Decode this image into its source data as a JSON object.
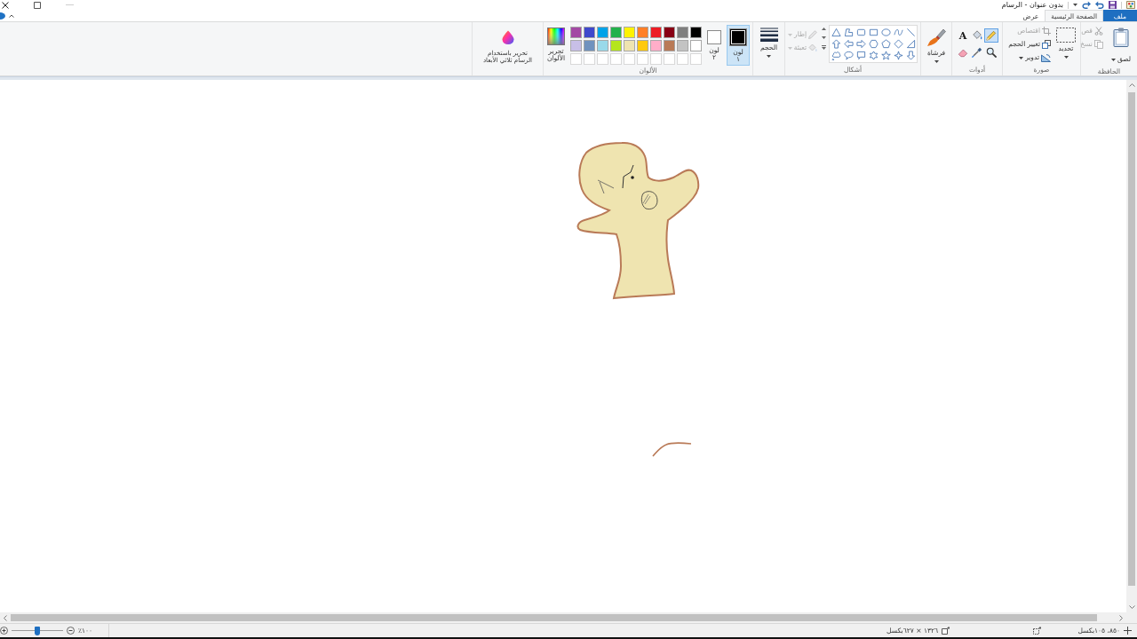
{
  "window": {
    "title": "بدون عنوان - الرسام"
  },
  "tabs": [
    {
      "label": "ملف",
      "kind": "file",
      "selected": false
    },
    {
      "label": "الصفحة الرئيسية",
      "kind": "tab",
      "selected": true
    },
    {
      "label": "عرض",
      "kind": "tab",
      "selected": false
    }
  ],
  "ribbon": {
    "clipboard": {
      "label": "الحافظة",
      "paste": "لصق",
      "cut": {
        "label": "قص",
        "disabled": true
      },
      "copy": {
        "label": "نسخ",
        "disabled": true
      }
    },
    "image": {
      "label": "صورة",
      "select": "تحديد",
      "crop": {
        "label": "اقتصاص",
        "disabled": true
      },
      "resize": {
        "label": "تغيير الحجم",
        "disabled": false
      },
      "rotate": {
        "label": "تدوير",
        "disabled": false
      }
    },
    "tools": {
      "label": "أدوات",
      "items": [
        {
          "kind": "pencil",
          "selected": true
        },
        {
          "kind": "fill",
          "selected": false
        },
        {
          "kind": "text",
          "glyph": "A",
          "selected": false
        },
        {
          "kind": "magnifier",
          "selected": false
        },
        {
          "kind": "picker",
          "selected": false
        },
        {
          "kind": "eraser",
          "selected": false
        }
      ]
    },
    "brushes": {
      "label": "فرشاة"
    },
    "shapes": {
      "label": "أشكال",
      "outline": {
        "label": "إطار",
        "disabled": true
      },
      "fill": {
        "label": "تعبئة",
        "disabled": true
      }
    },
    "size": {
      "label": "الحجم"
    },
    "colors": {
      "label": "الألوان",
      "color_1": {
        "label": "لون ١",
        "color": "#000000",
        "selected": true
      },
      "color_2": {
        "label": "لون ٢",
        "color": "#ffffff",
        "selected": false
      },
      "palette": [
        {
          "kind": "color",
          "color": "#000000"
        },
        {
          "kind": "color",
          "color": "#7f7f7f"
        },
        {
          "kind": "color",
          "color": "#880015"
        },
        {
          "kind": "color",
          "color": "#ed1c24"
        },
        {
          "kind": "color",
          "color": "#ff7f27"
        },
        {
          "kind": "color",
          "color": "#fff200"
        },
        {
          "kind": "color",
          "color": "#22b14c"
        },
        {
          "kind": "color",
          "color": "#00a2e8"
        },
        {
          "kind": "color",
          "color": "#3f48cc"
        },
        {
          "kind": "color",
          "color": "#a349a4"
        },
        {
          "kind": "color",
          "color": "#ffffff"
        },
        {
          "kind": "color",
          "color": "#c3c3c3"
        },
        {
          "kind": "color",
          "color": "#b97a57"
        },
        {
          "kind": "color",
          "color": "#ffaec9"
        },
        {
          "kind": "color",
          "color": "#ffc90e"
        },
        {
          "kind": "color",
          "color": "#efe4b0"
        },
        {
          "kind": "color",
          "color": "#b5e61d"
        },
        {
          "kind": "color",
          "color": "#99d9ea"
        },
        {
          "kind": "color",
          "color": "#7092be"
        },
        {
          "kind": "color",
          "color": "#c8bfe7"
        },
        {
          "kind": "empty"
        },
        {
          "kind": "empty"
        },
        {
          "kind": "empty"
        },
        {
          "kind": "empty"
        },
        {
          "kind": "empty"
        },
        {
          "kind": "empty"
        },
        {
          "kind": "empty"
        },
        {
          "kind": "empty"
        },
        {
          "kind": "empty"
        },
        {
          "kind": "empty"
        }
      ],
      "edit": "تحرير الألوان"
    },
    "paint_3d": {
      "label": "تحرير باستخدام الرسام ثلاثي الأبعاد"
    }
  },
  "status_bar": {
    "cursor_position": "٨٥٠، ١٠٥بكسل",
    "canvas_size": "١٣٢٦ × ٦٢٧بكسل",
    "zoom": "١٠٠٪",
    "zoom_slider": {
      "level": 0.5
    }
  }
}
